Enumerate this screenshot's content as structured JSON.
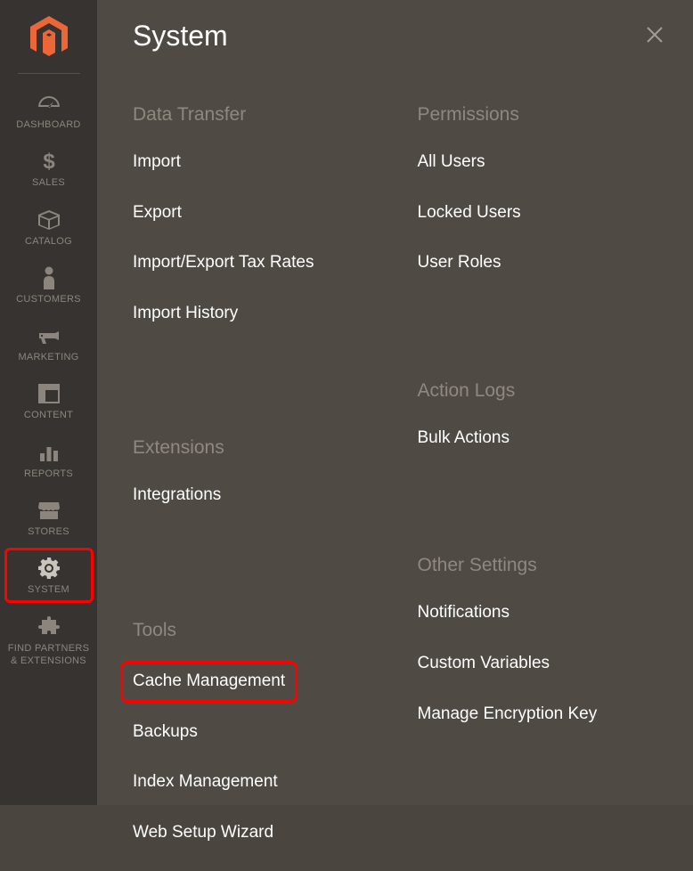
{
  "sidebar": {
    "items": [
      {
        "label": "DASHBOARD"
      },
      {
        "label": "SALES"
      },
      {
        "label": "CATALOG"
      },
      {
        "label": "CUSTOMERS"
      },
      {
        "label": "MARKETING"
      },
      {
        "label": "CONTENT"
      },
      {
        "label": "REPORTS"
      },
      {
        "label": "STORES"
      },
      {
        "label": "SYSTEM"
      },
      {
        "label": "FIND PARTNERS\n& EXTENSIONS"
      }
    ]
  },
  "panel": {
    "title": "System",
    "columns": [
      {
        "sections": [
          {
            "heading": "Data Transfer",
            "items": [
              "Import",
              "Export",
              "Import/Export Tax Rates",
              "Import History"
            ]
          },
          {
            "heading": "Extensions",
            "items": [
              "Integrations"
            ]
          },
          {
            "heading": "Tools",
            "items": [
              "Cache Management",
              "Backups",
              "Index Management",
              "Web Setup Wizard"
            ],
            "highlighted": "Cache Management"
          }
        ]
      },
      {
        "sections": [
          {
            "heading": "Permissions",
            "items": [
              "All Users",
              "Locked Users",
              "User Roles"
            ]
          },
          {
            "heading": "Action Logs",
            "items": [
              "Bulk Actions"
            ]
          },
          {
            "heading": "Other Settings",
            "items": [
              "Notifications",
              "Custom Variables",
              "Manage Encryption Key"
            ]
          }
        ]
      }
    ]
  }
}
